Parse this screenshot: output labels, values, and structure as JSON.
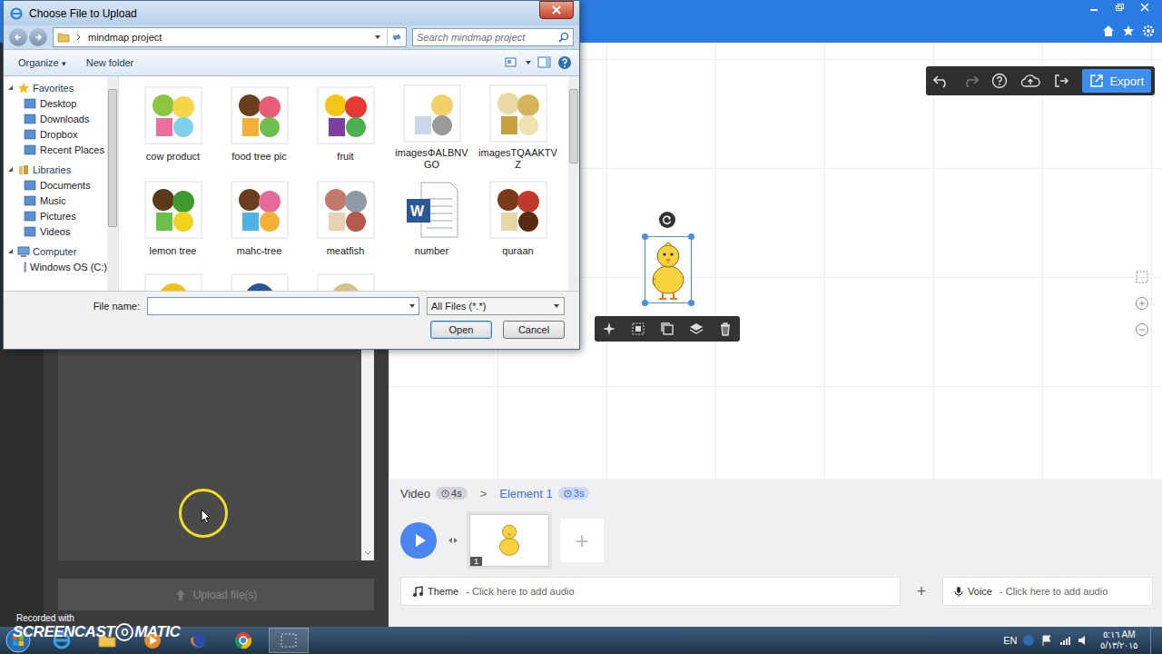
{
  "dialog": {
    "title": "Choose File to Upload",
    "path": "mindmap project",
    "search_placeholder": "Search mindmap project",
    "toolbar": {
      "organize": "Organize",
      "organize_arrow": "▾",
      "new_folder": "New folder"
    },
    "nav": [
      {
        "label": "Favorites",
        "expanded": true,
        "items": [
          "Desktop",
          "Downloads",
          "Dropbox",
          "Recent Places"
        ]
      },
      {
        "label": "Libraries",
        "expanded": true,
        "items": [
          "Documents",
          "Music",
          "Pictures",
          "Videos"
        ]
      },
      {
        "label": "Computer",
        "expanded": true,
        "items": [
          "Windows OS (C:)"
        ]
      }
    ],
    "files": [
      {
        "name": "cow product",
        "kind": "image",
        "badge": ""
      },
      {
        "name": "food tree pic",
        "kind": "image",
        "badge": ""
      },
      {
        "name": "fruit",
        "kind": "image",
        "badge": ""
      },
      {
        "name": "imagesΦALBNVGO",
        "kind": "image",
        "badge": ""
      },
      {
        "name": "imagesTQAAKTVZ",
        "kind": "image",
        "badge": ""
      },
      {
        "name": "lemon tree",
        "kind": "image",
        "badge": ""
      },
      {
        "name": "mahc-tree",
        "kind": "image",
        "badge": ""
      },
      {
        "name": "meatfish",
        "kind": "image",
        "badge": ""
      },
      {
        "name": "number",
        "kind": "document",
        "badge": "W"
      },
      {
        "name": "quraan",
        "kind": "image",
        "badge": ""
      }
    ],
    "file_name": {
      "label": "File name:",
      "value": ""
    },
    "filter": "All Files (*.*)",
    "buttons": [
      {
        "label": "Open",
        "default": true
      },
      {
        "label": "Cancel",
        "default": false
      }
    ]
  },
  "editor": {
    "upload_button": "Upload file(s)",
    "export": "Export",
    "timeline": {
      "video_label": "Video",
      "video_duration": "4s",
      "separator": ">",
      "element_label": "Element 1",
      "element_duration": "3s",
      "scenes": [
        {
          "number": "1",
          "selected": true
        }
      ],
      "add": "+"
    },
    "audio": [
      {
        "label": "Theme",
        "hint": " - Click here to add audio"
      },
      {
        "label": "Voice",
        "hint": " - Click here to add audio"
      }
    ],
    "audio_add": "+"
  },
  "taskbar": {
    "language": "EN",
    "time": "٥:١٦ AM",
    "date": "٥/١٣/٢٠١٥"
  },
  "watermark": {
    "line1": "Recorded with",
    "brand_left": "SCREENCAST",
    "brand_o": "O",
    "brand_right": "MATIC"
  }
}
